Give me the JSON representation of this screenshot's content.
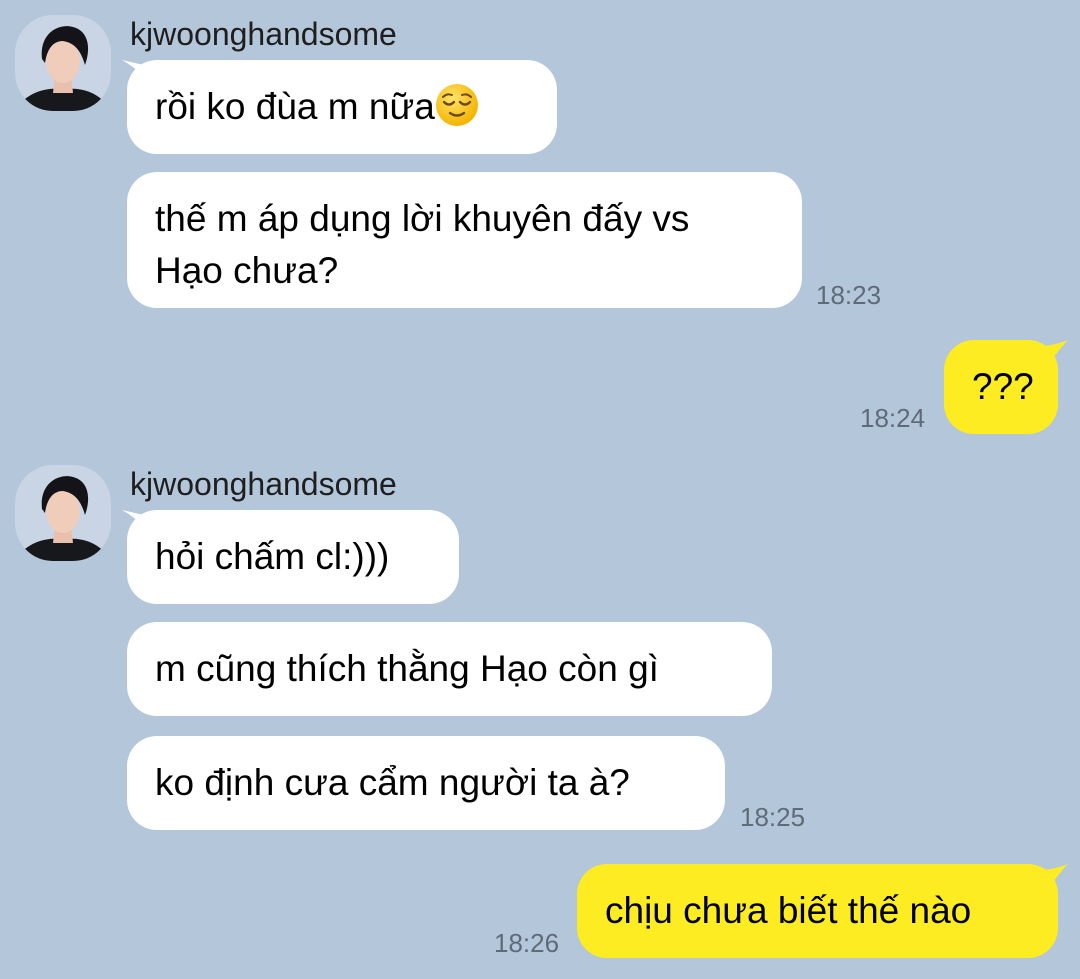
{
  "chat": {
    "groups": [
      {
        "sender": "kjwoonghandsome",
        "messages": [
          {
            "text": "rồi ko đùa m nữa",
            "emoji": "relieved-face"
          },
          {
            "line1": "thế m áp dụng lời khuyên đấy vs",
            "line2": "Hạo chưa?"
          }
        ],
        "time": "18:23"
      },
      {
        "sender": "kjwoonghandsome",
        "messages": [
          {
            "text": "hỏi chấm cl:)))"
          },
          {
            "text": "m cũng thích thằng Hạo còn gì"
          },
          {
            "text": "ko định cưa cẩm người ta à?"
          }
        ],
        "time": "18:25"
      }
    ],
    "outgoing": [
      {
        "text": "???",
        "time": "18:24"
      },
      {
        "text": "chịu chưa biết thế nào",
        "time": "18:26"
      }
    ]
  },
  "colors": {
    "background": "#b3c6da",
    "incoming_bubble": "#ffffff",
    "outgoing_bubble": "#fdec21"
  }
}
